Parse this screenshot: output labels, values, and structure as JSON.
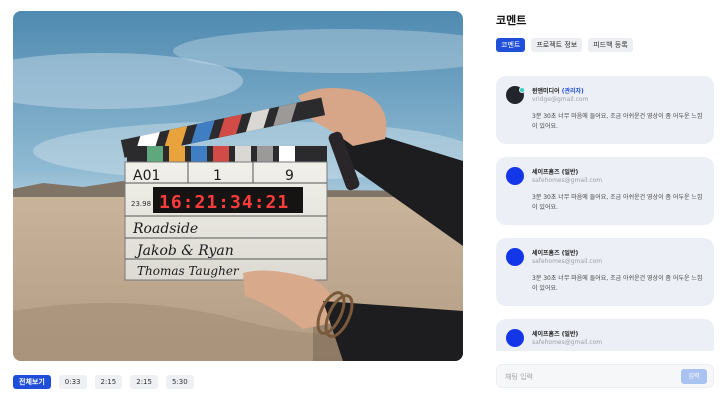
{
  "video": {
    "clapper": {
      "roll": "A01",
      "scene": "1",
      "take": "9",
      "fps": "23.98",
      "timecode": "16:21:34:21",
      "production": "Roadside",
      "director": "Jakob & Ryan",
      "camera": "Thomas Taugher"
    },
    "timestamps": [
      "전체보기",
      "0:33",
      "2:15",
      "2:15",
      "5:30"
    ]
  },
  "panel": {
    "title": "코멘트",
    "tabs": [
      "코멘트",
      "프로젝트 정보",
      "피드백 등록"
    ]
  },
  "comments": [
    {
      "name": "윈앤미디어",
      "role": "(관리자)",
      "email": "vridge@gmail.com",
      "text": "3분 30초 너무 마음에 들어요, 조금 아쉬운건 영상이 좀 어두운 느낌이 있어요."
    },
    {
      "name": "세이프홈즈 (일반)",
      "role": "",
      "email": "safehomes@gmail.com",
      "text": "3분 30초 너무 마음에 들어요, 조금 아쉬운건 영상이 좀 어두운 느낌이 있어요."
    },
    {
      "name": "세이프홈즈 (일반)",
      "role": "",
      "email": "safehomes@gmail.com",
      "text": "3분 30초 너무 마음에 들어요, 조금 아쉬운건 영상이 좀 어두운 느낌이 있어요."
    },
    {
      "name": "세이프홈즈 (일반)",
      "role": "",
      "email": "safehomes@gmail.com",
      "text": ""
    }
  ],
  "composer": {
    "placeholder": "채팅 입력",
    "send_label": "입력"
  },
  "colors": {
    "accent": "#1f4fd8",
    "card_bg": "#eceff5",
    "avatar_blue": "#1336e8",
    "avatar_dark": "#23252c"
  }
}
